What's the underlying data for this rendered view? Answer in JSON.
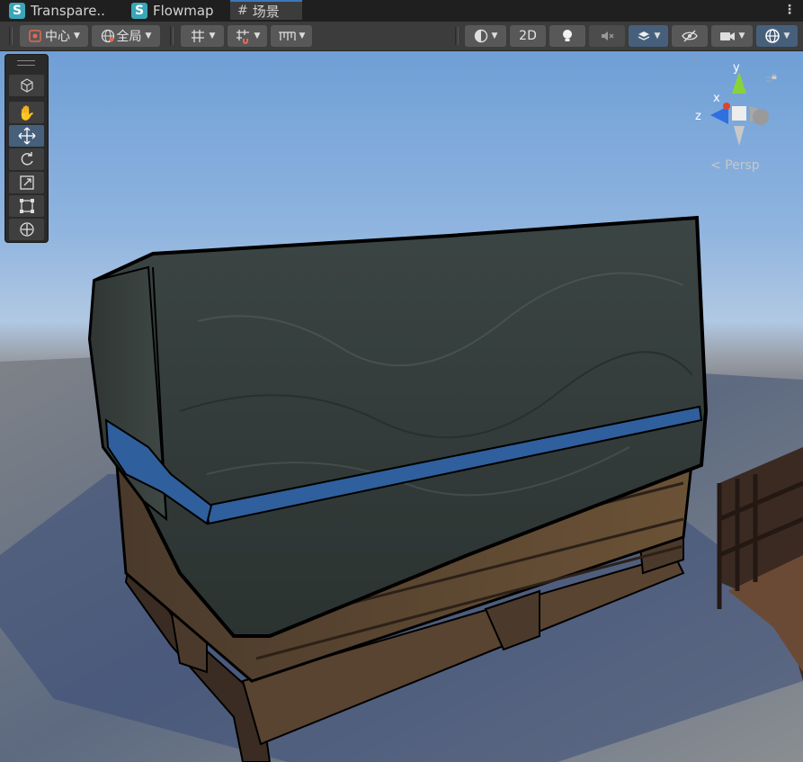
{
  "tabs": [
    {
      "label": "Transpare..",
      "icon": "shader-icon"
    },
    {
      "label": "Flowmap",
      "icon": "shader-icon"
    },
    {
      "label": "场景",
      "icon": "grid-icon"
    }
  ],
  "toolbar": {
    "pivot_label": "中心",
    "space_label": "全局",
    "mode_2d_label": "2D"
  },
  "scene": {
    "camera_label": "Persp",
    "gizmo_axes": {
      "x": "x",
      "y": "y",
      "z": "z"
    }
  },
  "colors": {
    "accent": "#46607c",
    "tab_accent": "#3a79bb",
    "shader_icon": "#3aa7b8"
  }
}
